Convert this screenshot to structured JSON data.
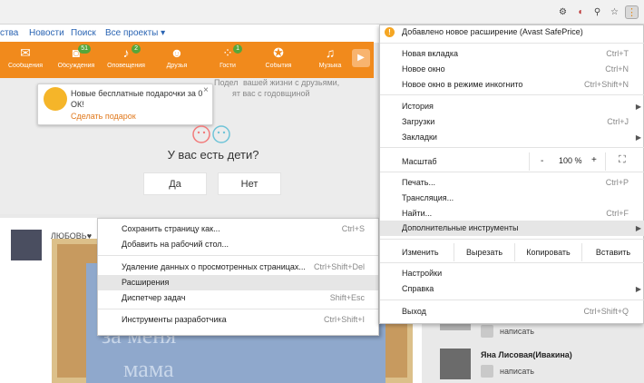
{
  "colors": {
    "accent": "#f18a1c",
    "link": "#2a64b3",
    "badge": "#56a63a",
    "gift_link": "#e0781c"
  },
  "toolbar": {
    "icons": [
      "extension-puzzle-icon",
      "avast-safeprice-icon",
      "pin-icon",
      "star-icon",
      "menu-icon"
    ]
  },
  "nav_links": [
    "ства",
    "Новости",
    "Поиск",
    "Все проекты ▾"
  ],
  "nav_icons": [
    {
      "label": "Сообщения",
      "icon": "envelope-icon",
      "glyph": "✉",
      "badge": ""
    },
    {
      "label": "Обсуждения",
      "icon": "chat-icon",
      "glyph": "💬",
      "badge": "51"
    },
    {
      "label": "Оповещения",
      "icon": "bell-icon",
      "glyph": "🔔",
      "badge": "2"
    },
    {
      "label": "Друзья",
      "icon": "friends-icon",
      "glyph": "👥",
      "badge": ""
    },
    {
      "label": "Гости",
      "icon": "footprints-icon",
      "glyph": "👣",
      "badge": "1"
    },
    {
      "label": "События",
      "icon": "events-icon",
      "glyph": "👍",
      "badge": ""
    },
    {
      "label": "Музыка",
      "icon": "music-icon",
      "glyph": "♫",
      "badge": ""
    }
  ],
  "feed": {
    "behind_text1": "Подел",
    "behind_text2": "вашей жизни с друзьями,",
    "behind_text3": "ят вас с годовщиной",
    "question": "У вас есть дети?",
    "yes": "Да",
    "no": "Нет"
  },
  "gift_tooltip": {
    "text": "Новые бесплатные подарочки за 0 ОК!",
    "link": "Сделать подарок",
    "close": "×"
  },
  "post": {
    "author": "ЛЮБОВЬ♥"
  },
  "friends": [
    {
      "name": "",
      "action": "написать"
    },
    {
      "name": "Яна Лисовая(Ивакина)",
      "action": "написать"
    }
  ],
  "photo_text": [
    "за меня",
    "мама"
  ],
  "context_menu_page": {
    "items": [
      {
        "label": "Сохранить страницу как...",
        "shortcut": "Ctrl+S"
      },
      {
        "label": "Добавить на рабочий стол...",
        "shortcut": ""
      },
      {
        "label": "Удаление данных о просмотренных страницах...",
        "shortcut": "Ctrl+Shift+Del"
      },
      {
        "label": "Расширения",
        "shortcut": ""
      },
      {
        "label": "Диспетчер задач",
        "shortcut": "Shift+Esc"
      },
      {
        "label": "Инструменты разработчика",
        "shortcut": "Ctrl+Shift+I"
      }
    ]
  },
  "chrome_menu": {
    "notice": "Добавлено новое расширение (Avast SafePrice)",
    "new_tab": {
      "label": "Новая вкладка",
      "shortcut": "Ctrl+T"
    },
    "new_window": {
      "label": "Новое окно",
      "shortcut": "Ctrl+N"
    },
    "incognito": {
      "label": "Новое окно в режиме инкогнито",
      "shortcut": "Ctrl+Shift+N"
    },
    "history": {
      "label": "История",
      "shortcut": ""
    },
    "downloads": {
      "label": "Загрузки",
      "shortcut": "Ctrl+J"
    },
    "bookmarks": {
      "label": "Закладки",
      "shortcut": ""
    },
    "zoom": {
      "label": "Масштаб",
      "minus": "-",
      "value": "100 %",
      "plus": "+"
    },
    "print": {
      "label": "Печать...",
      "shortcut": "Ctrl+P"
    },
    "cast": {
      "label": "Трансляция...",
      "shortcut": ""
    },
    "find": {
      "label": "Найти...",
      "shortcut": "Ctrl+F"
    },
    "more_tools": {
      "label": "Дополнительные инструменты",
      "shortcut": ""
    },
    "edit": {
      "label": "Изменить",
      "cut": "Вырезать",
      "copy": "Копировать",
      "paste": "Вставить"
    },
    "settings": {
      "label": "Настройки",
      "shortcut": ""
    },
    "help": {
      "label": "Справка",
      "shortcut": ""
    },
    "exit": {
      "label": "Выход",
      "shortcut": "Ctrl+Shift+Q"
    }
  }
}
